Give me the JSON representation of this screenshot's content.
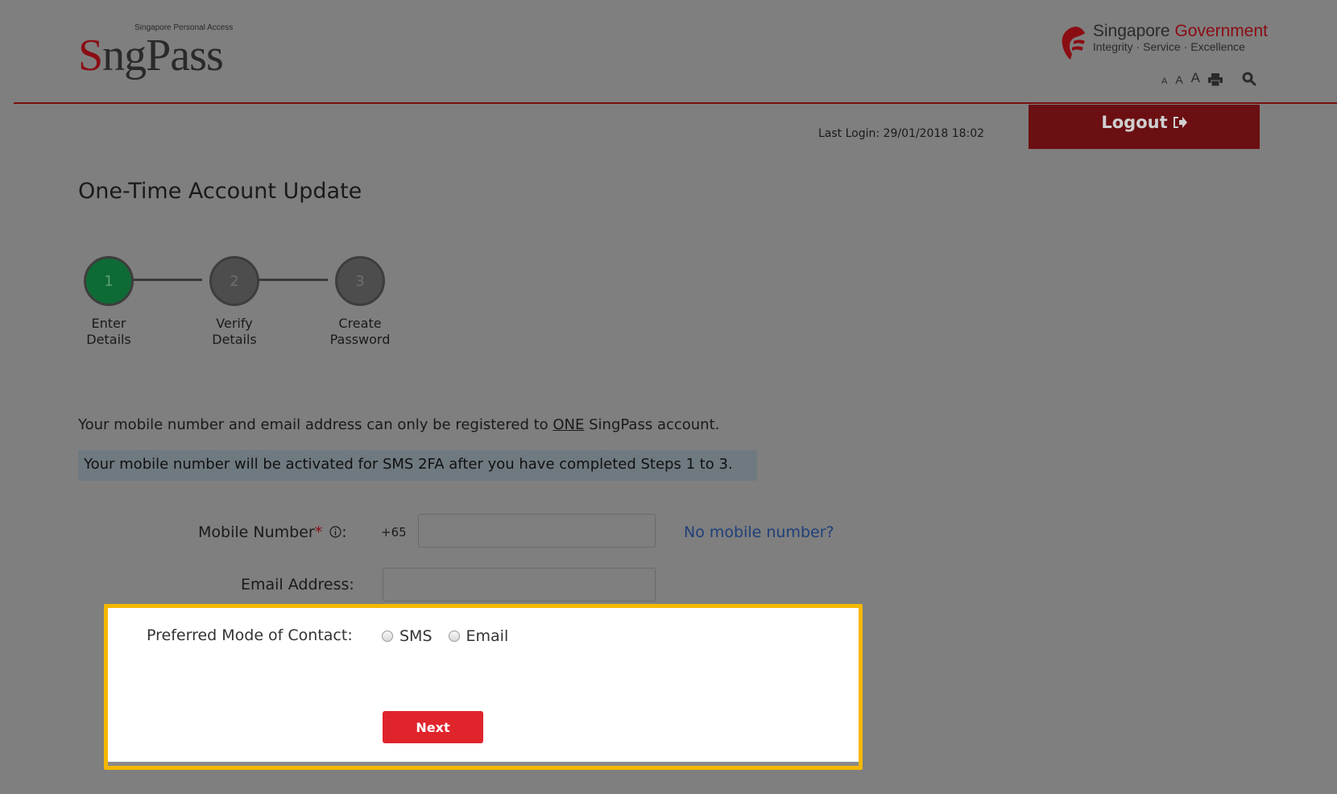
{
  "header": {
    "logo_subtitle": "Singapore Personal Access",
    "logo_s": "S",
    "logo_rest": "ngPass",
    "gov_title_a": "Singapore ",
    "gov_title_b": "Government",
    "gov_tagline": "Integrity · Service · Excellence",
    "font_small": "A",
    "font_medium": "A",
    "font_large": "A"
  },
  "topbar": {
    "last_login": "Last Login: 29/01/2018 18:02",
    "logout_label": "Logout"
  },
  "page_title": "One-Time Account Update",
  "stepper": {
    "steps": [
      {
        "number": "1",
        "label_line1": "Enter",
        "label_line2": "Details",
        "active": true
      },
      {
        "number": "2",
        "label_line1": "Verify",
        "label_line2": "Details",
        "active": false
      },
      {
        "number": "3",
        "label_line1": "Create",
        "label_line2": "Password",
        "active": false
      }
    ]
  },
  "info": {
    "line1_pre": "Your mobile number and email address can only be registered to ",
    "line1_emph": "ONE",
    "line1_post": " SingPass account.",
    "line2": "Your mobile number will be activated for SMS 2FA after you have completed Steps 1 to 3."
  },
  "form": {
    "mobile_label": "Mobile Number",
    "mobile_required": "*",
    "mobile_prefix": "+65",
    "mobile_value": "",
    "no_mobile_link": "No mobile number?",
    "email_label": "Email Address:",
    "email_value": "",
    "pref_label": "Preferred Mode of Contact:",
    "pref_options": [
      "SMS",
      "Email"
    ],
    "next_label": "Next"
  },
  "colors": {
    "brand_red": "#8b0d14",
    "logout_bg": "#6b0f12",
    "active_step": "#0f6b35",
    "next_button": "#e0242c",
    "highlight_border": "#f5b800"
  }
}
